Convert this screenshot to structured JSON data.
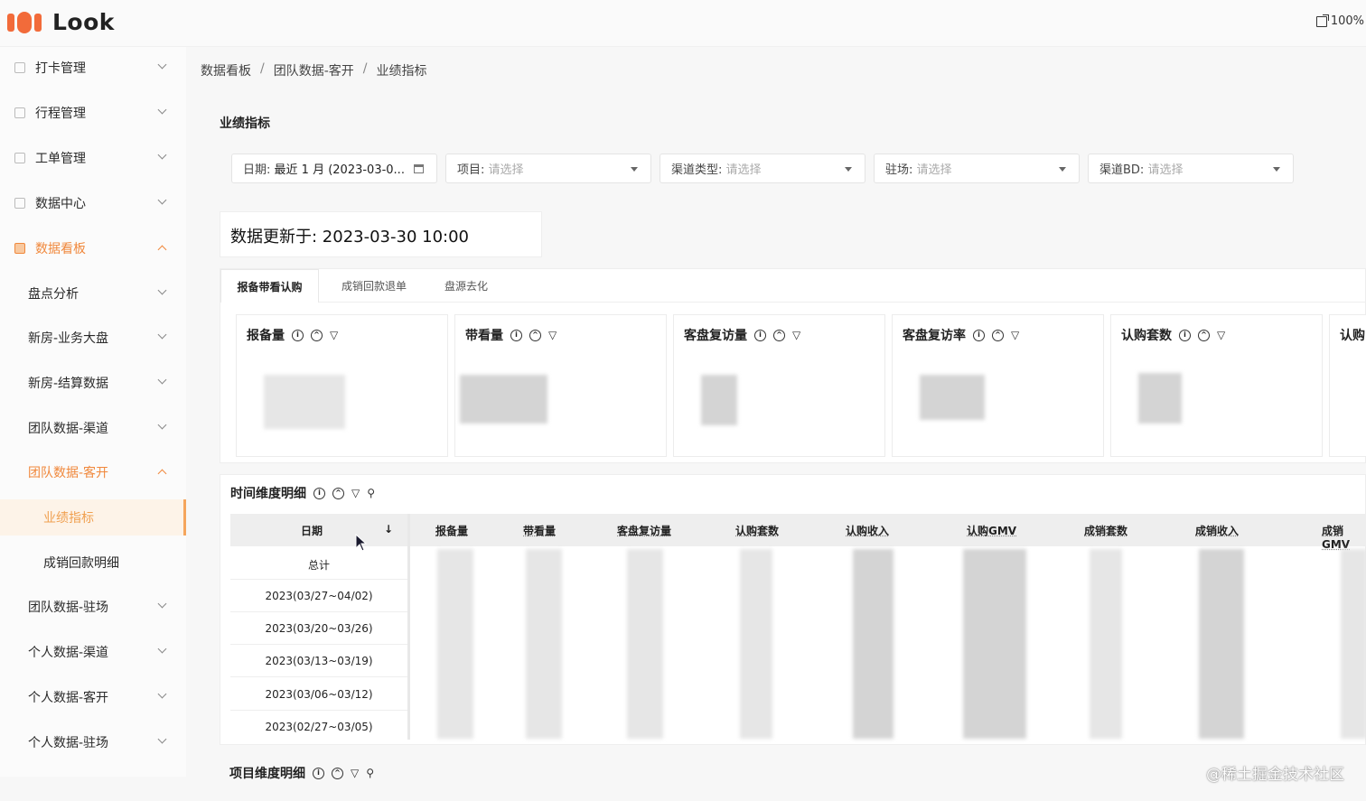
{
  "app": {
    "logo_text": "Look",
    "zoom": "100%"
  },
  "sidebar": {
    "items": [
      {
        "label": "打卡管理"
      },
      {
        "label": "行程管理"
      },
      {
        "label": "工单管理"
      },
      {
        "label": "数据中心"
      },
      {
        "label": "数据看板"
      },
      {
        "label": "盘点分析"
      },
      {
        "label": "新房-业务大盘"
      },
      {
        "label": "新房-结算数据"
      },
      {
        "label": "团队数据-渠道"
      },
      {
        "label": "团队数据-客开"
      },
      {
        "label": "业绩指标"
      },
      {
        "label": "成销回款明细"
      },
      {
        "label": "团队数据-驻场"
      },
      {
        "label": "个人数据-渠道"
      },
      {
        "label": "个人数据-客开"
      },
      {
        "label": "个人数据-驻场"
      }
    ]
  },
  "breadcrumb": {
    "level1": "数据看板",
    "level2": "团队数据-客开",
    "level3": "业绩指标",
    "sep": "/"
  },
  "page_title": "业绩指标",
  "filters": {
    "date": {
      "label": "日期:",
      "value": "最近 1 月 (2023-03-0..."
    },
    "project": {
      "label": "项目:",
      "placeholder": "请选择"
    },
    "channel_type": {
      "label": "渠道类型:",
      "placeholder": "请选择"
    },
    "resident": {
      "label": "驻场:",
      "placeholder": "请选择"
    },
    "channel_bd": {
      "label": "渠道BD:",
      "placeholder": "请选择"
    }
  },
  "update": {
    "text": "数据更新于: 2023-03-30 10:00"
  },
  "tabs": [
    "报备带看认购",
    "成销回款退单",
    "盘源去化"
  ],
  "metrics": [
    "报备量",
    "带看量",
    "客盘复访量",
    "客盘复访率",
    "认购套数",
    "认购"
  ],
  "time_detail": {
    "title": "时间维度明细",
    "columns": [
      "日期",
      "报备量",
      "带看量",
      "客盘复访量",
      "认购套数",
      "认购收入",
      "认购GMV",
      "成销套数",
      "成销收入",
      "成销GMV"
    ],
    "sort_glyph": "↓",
    "rows": [
      "总计",
      "2023(03/27~04/02)",
      "2023(03/20~03/26)",
      "2023(03/13~03/19)",
      "2023(03/06~03/12)",
      "2023(02/27~03/05)"
    ]
  },
  "project_detail": {
    "title": "项目维度明细"
  },
  "credit": "@稀土掘金技术社区",
  "colors": {
    "accent": "#f0883c",
    "logo": "#f26b3a"
  }
}
